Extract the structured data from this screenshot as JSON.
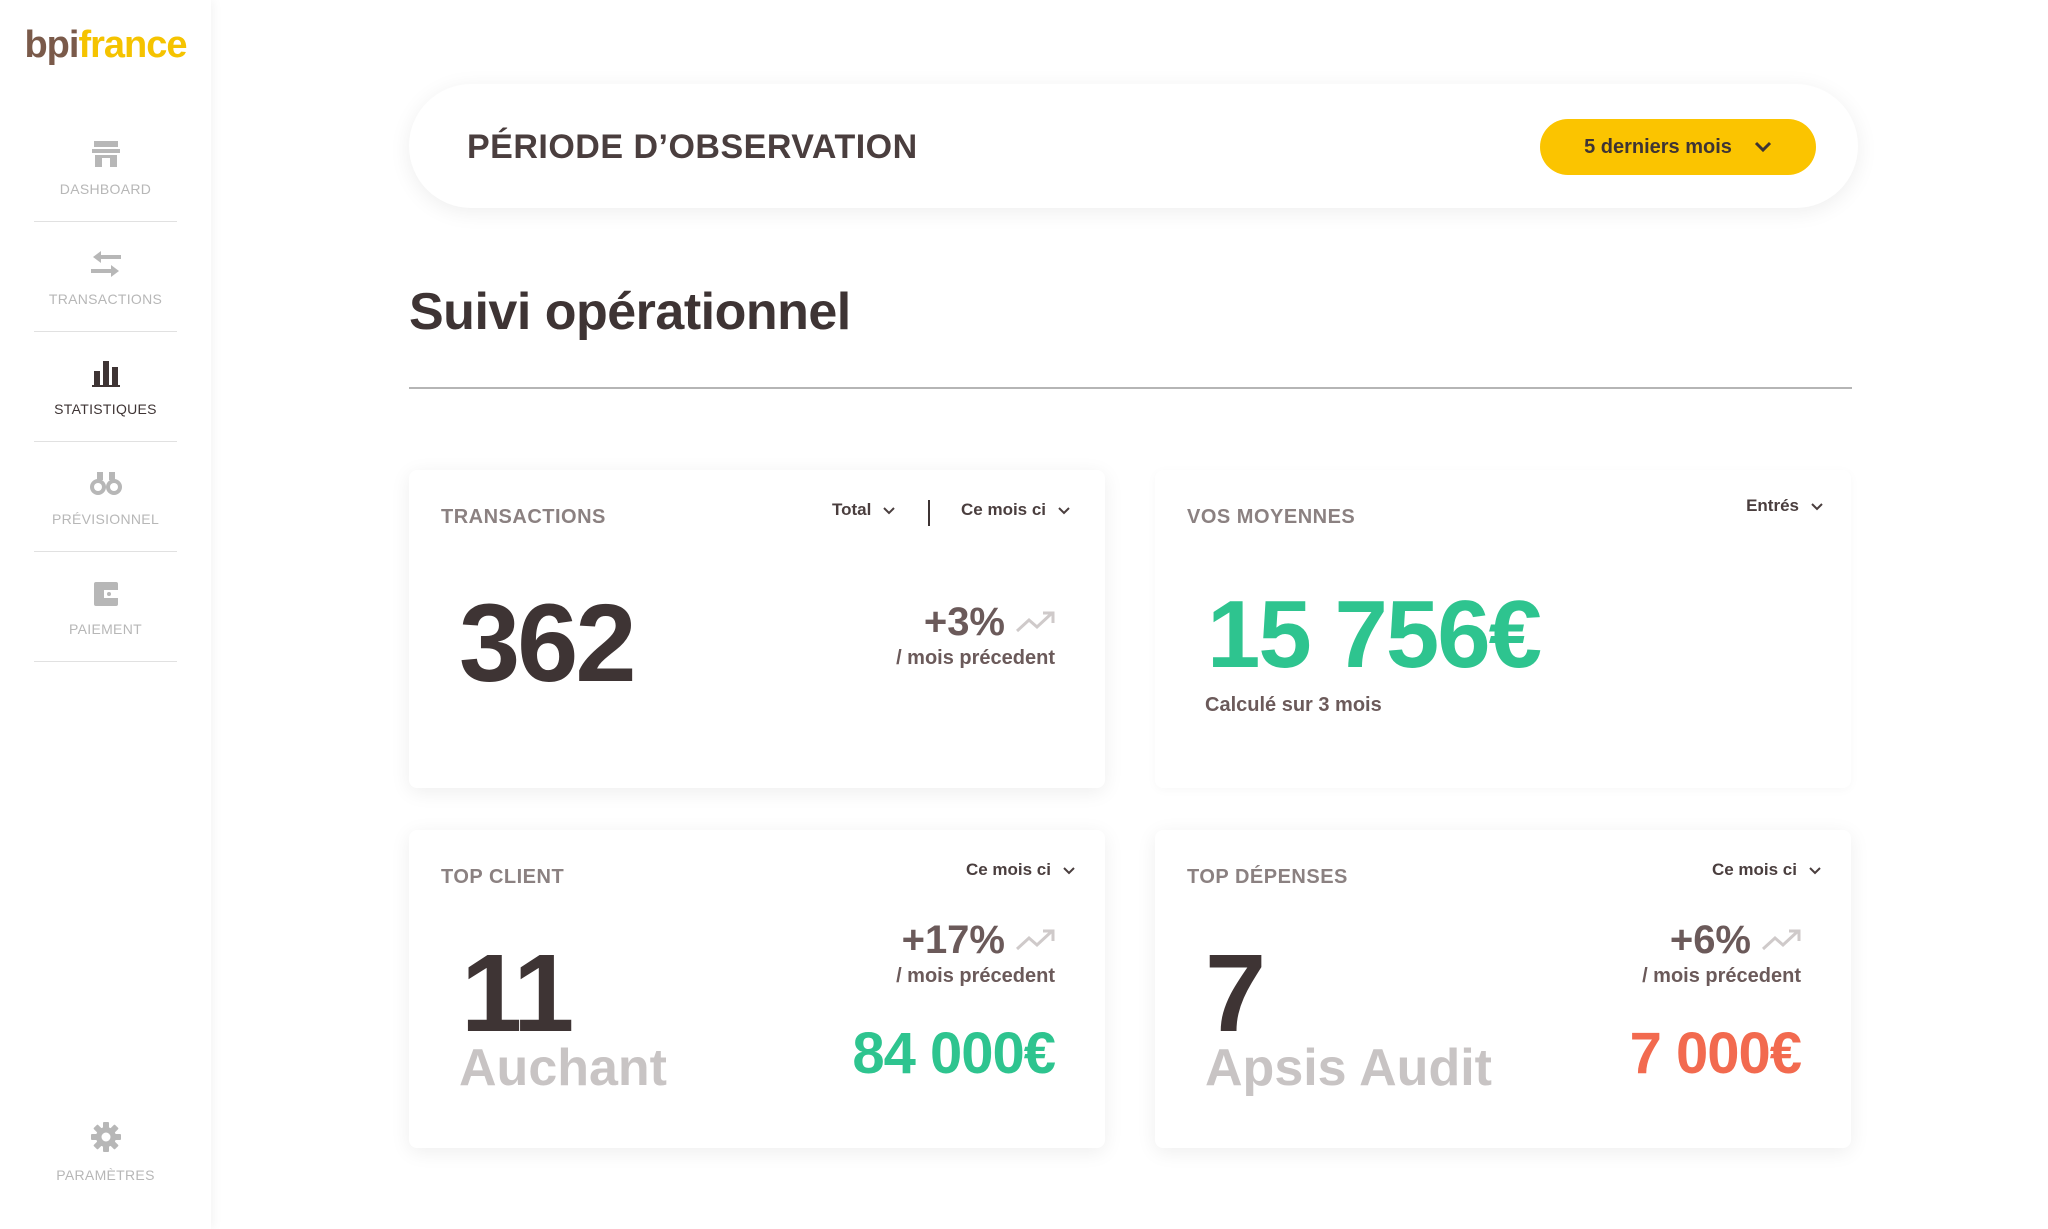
{
  "brand": {
    "logo_part1": "bpi",
    "logo_part2": "france"
  },
  "sidebar": {
    "items": [
      {
        "label": "DASHBOARD",
        "icon": "store-icon",
        "active": false
      },
      {
        "label": "TRANSACTIONS",
        "icon": "transfer-arrows-icon",
        "active": false
      },
      {
        "label": "STATISTIQUES",
        "icon": "bar-chart-icon",
        "active": true
      },
      {
        "label": "PRÉVISIONNEL",
        "icon": "binoculars-icon",
        "active": false
      },
      {
        "label": "PAIEMENT",
        "icon": "wallet-icon",
        "active": false
      }
    ],
    "settings": {
      "label": "PARAMÈTRES",
      "icon": "gear-icon"
    }
  },
  "period": {
    "title": "PÉRIODE D’OBSERVATION",
    "selected": "5 derniers mois"
  },
  "section": {
    "title": "Suivi opérationnel"
  },
  "cards": {
    "transactions": {
      "title": "TRANSACTIONS",
      "filter_type": "Total",
      "filter_period": "Ce mois ci",
      "value": "362",
      "delta": "+3%",
      "delta_sub": "/ mois précedent"
    },
    "moyennes": {
      "title": "VOS MOYENNES",
      "filter": "Entrés",
      "value": "15 756€",
      "note": "Calculé sur 3 mois"
    },
    "top_client": {
      "title": "TOP CLIENT",
      "filter_period": "Ce mois ci",
      "rank": "11",
      "name": "Auchant",
      "delta": "+17%",
      "delta_sub": "/ mois précedent",
      "amount": "84 000€"
    },
    "top_depenses": {
      "title": "TOP DÉPENSES",
      "filter_period": "Ce mois ci",
      "rank": "7",
      "name": "Apsis Audit",
      "delta": "+6%",
      "delta_sub": "/ mois précedent",
      "amount": "7 000€"
    }
  },
  "colors": {
    "accent": "#fbc400",
    "positive": "#2ec48f",
    "negative": "#f26a4f",
    "text_dark": "#3e3434",
    "muted": "#b7b7b7"
  }
}
